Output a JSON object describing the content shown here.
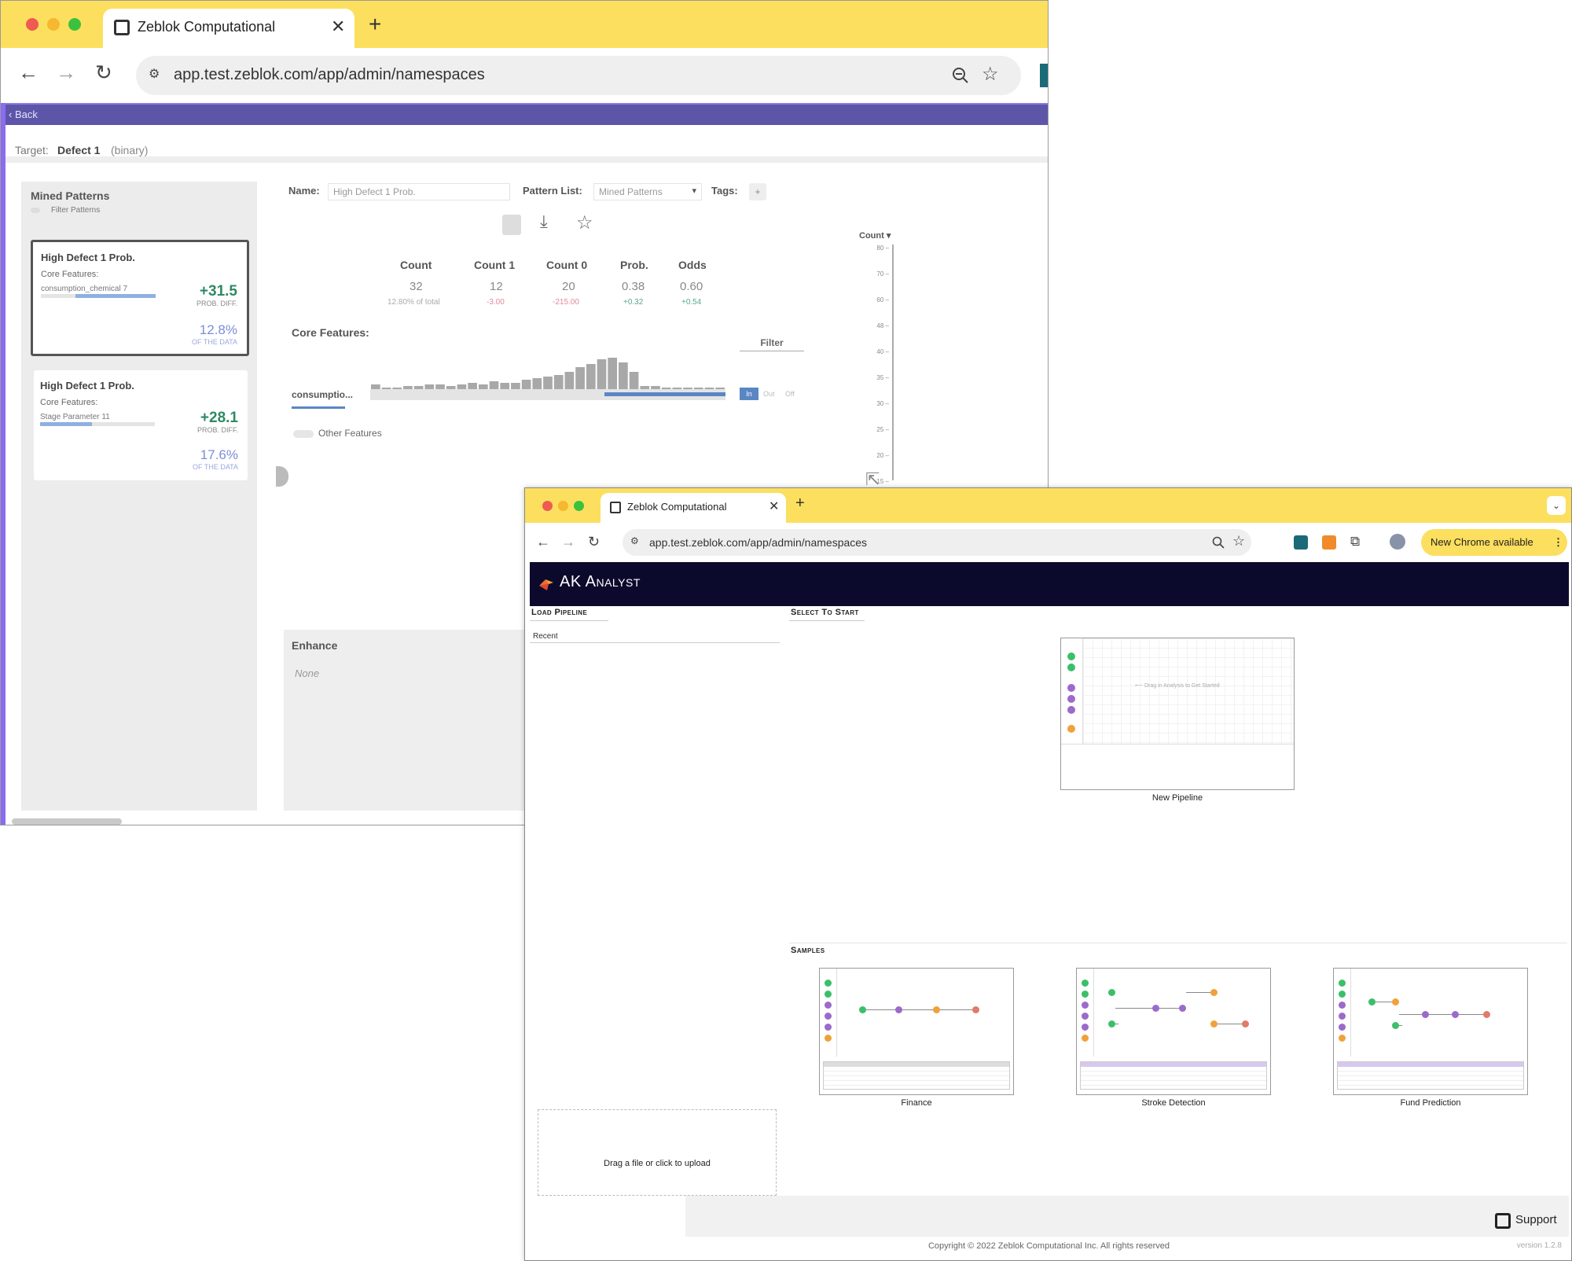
{
  "back_window": {
    "tab_title": "Zeblok Computational",
    "new_tab": "+",
    "close": "✕",
    "url": "app.test.zeblok.com/app/admin/namespaces",
    "back_label": "Back",
    "target_label": "Target:",
    "target_value": "Defect 1",
    "target_type": "(binary)",
    "mined_patterns_title": "Mined Patterns",
    "filter_patterns": "Filter Patterns",
    "patterns": [
      {
        "title": "High Defect 1 Prob.",
        "core_label": "Core Features:",
        "feature": "consumption_chemical 7",
        "diff": "+31.5",
        "diff_label": "PROB. DIFF.",
        "pct": "12.8%",
        "pct_label": "OF THE DATA",
        "fill": 0.7
      },
      {
        "title": "High Defect 1 Prob.",
        "core_label": "Core Features:",
        "feature": "Stage Parameter 11",
        "diff": "+28.1",
        "diff_label": "PROB. DIFF.",
        "pct": "17.6%",
        "pct_label": "OF THE DATA",
        "fill": 0.45
      }
    ],
    "name_label": "Name:",
    "name_value": "High Defect 1 Prob.",
    "pattern_list_label": "Pattern List:",
    "pattern_list_value": "Mined Patterns",
    "tags_label": "Tags:",
    "tags_add": "+",
    "stats": [
      {
        "head": "Count",
        "value": "32",
        "sub": "12.80% of total"
      },
      {
        "head": "Count 1",
        "value": "12",
        "sub": "-3.00"
      },
      {
        "head": "Count 0",
        "value": "20",
        "sub": "-215.00"
      },
      {
        "head": "Prob.",
        "value": "0.38",
        "sub": "+0.32"
      },
      {
        "head": "Odds",
        "value": "0.60",
        "sub": "+0.54"
      }
    ],
    "core_features_title": "Core Features:",
    "filter_label": "Filter",
    "feature_chip": "consumptio...",
    "filter_options": [
      "In",
      "Out",
      "Off"
    ],
    "histogram_values": [
      3,
      1,
      1,
      2,
      2,
      3,
      3,
      2,
      3,
      4,
      3,
      5,
      4,
      4,
      6,
      7,
      8,
      9,
      11,
      14,
      16,
      19,
      20,
      17,
      11,
      2,
      2,
      1,
      1,
      1,
      1,
      1,
      1
    ],
    "other_features": "Other Features",
    "count_axis_label": "Count",
    "count_ticks": [
      "80",
      "70",
      "60",
      "48",
      "40",
      "35",
      "30",
      "25",
      "20",
      "15"
    ],
    "enhance_title": "Enhance",
    "enhance_value": "None"
  },
  "front_window": {
    "tab_title": "Zeblok Computational",
    "new_tab": "+",
    "close": "✕",
    "url": "app.test.zeblok.com/app/admin/namespaces",
    "new_chrome": "New Chrome available",
    "app_name": "AK Analyst",
    "load_pipeline": "Load Pipeline",
    "recent": "Recent",
    "select_to_start": "Select To Start",
    "new_pipeline_hint": "Drag in Analysis to Get Started",
    "new_pipeline": "New Pipeline",
    "samples": "Samples",
    "sample_items": [
      "Finance",
      "Stroke Detection",
      "Fund Prediction"
    ],
    "upload": "Drag a file or click to upload",
    "support": "Support",
    "copyright": "Copyright © 2022 Zeblok Computational Inc. All rights reserved",
    "version": "version 1.2.8"
  },
  "colors": {
    "chrome_yellow": "#fcdf5e",
    "back_bar": "#5d56a8",
    "ak_header": "#0c0a2c",
    "positive": "#2e8a63",
    "blue": "#7c8ed8"
  }
}
